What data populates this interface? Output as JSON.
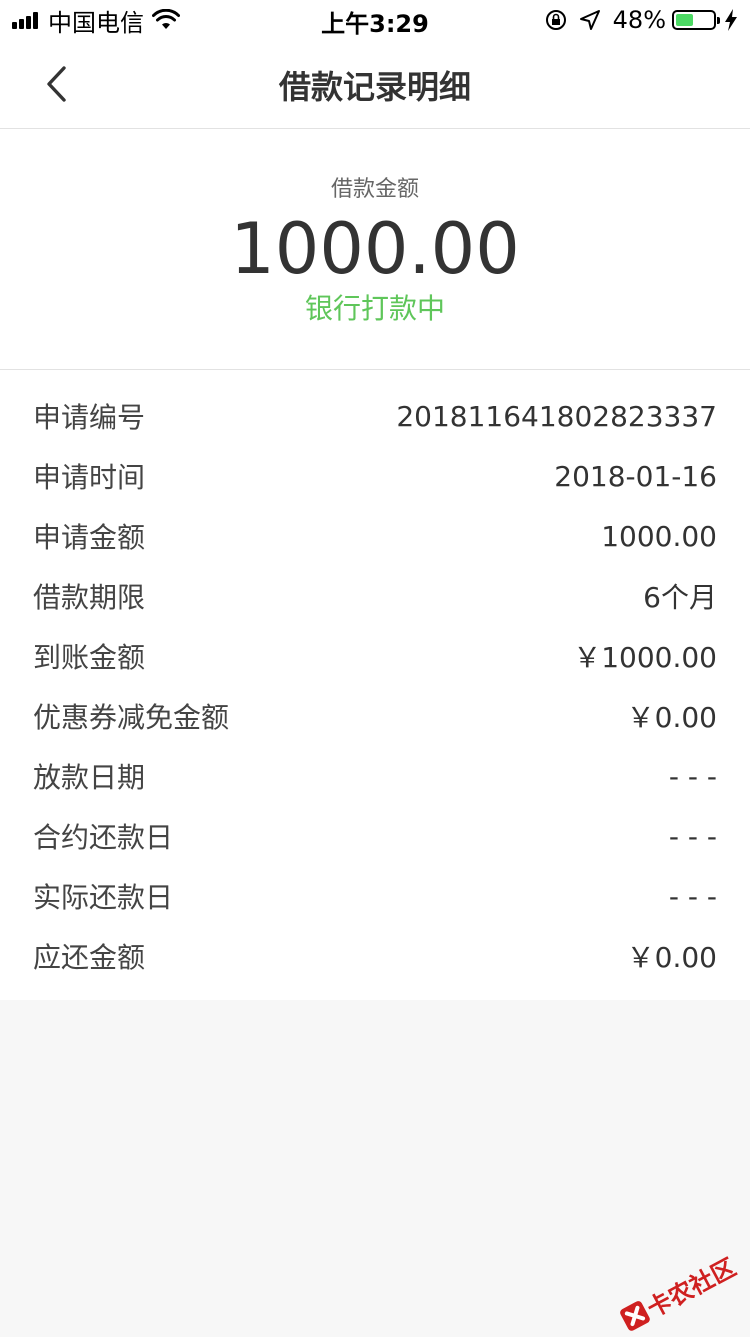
{
  "status_bar": {
    "carrier": "中国电信",
    "time": "上午3:29",
    "battery_percent": "48%",
    "battery_level": 0.48
  },
  "nav": {
    "title": "借款记录明细"
  },
  "summary": {
    "label": "借款金额",
    "amount": "1000.00",
    "status": "银行打款中",
    "status_color": "#5fc65a"
  },
  "details": [
    {
      "label": "申请编号",
      "value": "201811641802823337"
    },
    {
      "label": "申请时间",
      "value": "2018-01-16"
    },
    {
      "label": "申请金额",
      "value": "1000.00"
    },
    {
      "label": "借款期限",
      "value": "6个月"
    },
    {
      "label": "到账金额",
      "value": "￥1000.00"
    },
    {
      "label": "优惠券减免金额",
      "value": "￥0.00"
    },
    {
      "label": "放款日期",
      "value": "- - -"
    },
    {
      "label": "合约还款日",
      "value": "- - -"
    },
    {
      "label": "实际还款日",
      "value": "- - -"
    },
    {
      "label": "应还金额",
      "value": "￥0.00"
    }
  ],
  "watermark": {
    "text": "卡农社区"
  }
}
